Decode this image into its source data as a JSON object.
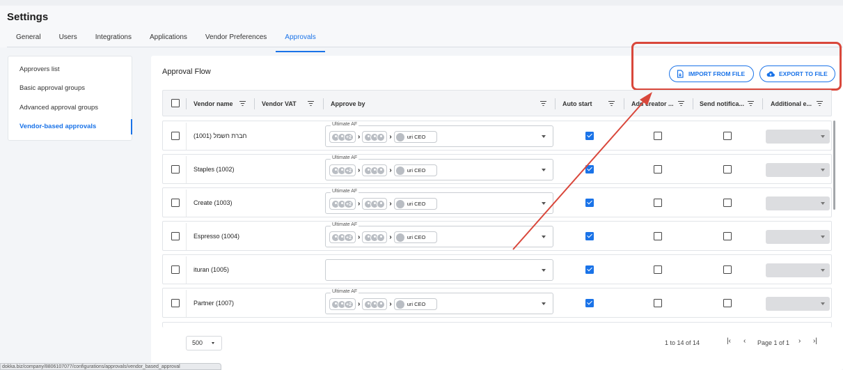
{
  "page": {
    "title": "Settings"
  },
  "tabs": [
    "General",
    "Users",
    "Integrations",
    "Applications",
    "Vendor Preferences",
    "Approvals"
  ],
  "active_tab": "Approvals",
  "sidebar": {
    "items": [
      {
        "label": "Approvers list"
      },
      {
        "label": "Basic approval groups"
      },
      {
        "label": "Advanced approval groups"
      },
      {
        "label": "Vendor-based approvals"
      }
    ],
    "active": "Vendor-based approvals"
  },
  "panel": {
    "title": "Approval Flow",
    "import_label": "IMPORT FROM FILE",
    "export_label": "EXPORT TO FILE"
  },
  "table": {
    "columns": [
      "Vendor name",
      "Vendor VAT",
      "Approve by",
      "Auto start",
      "Add creator ...",
      "Send notifica...",
      "Additional e..."
    ],
    "rows": [
      {
        "vendor": "חברת חשמל (1001)",
        "legend": "Ultimate AF",
        "approver": "uri CEO",
        "auto_start": true
      },
      {
        "vendor": "Staples (1002)",
        "legend": "Ultimate AF",
        "approver": "uri CEO",
        "auto_start": true
      },
      {
        "vendor": "Create (1003)",
        "legend": "Ultimate AF",
        "approver": "uri CEO",
        "auto_start": true
      },
      {
        "vendor": "Espresso (1004)",
        "legend": "Ultimate AF",
        "approver": "uri CEO",
        "auto_start": true
      },
      {
        "vendor": "ituran (1005)",
        "legend": "",
        "approver": "",
        "auto_start": true
      },
      {
        "vendor": "Partner (1007)",
        "legend": "Ultimate AF",
        "approver": "uri CEO",
        "auto_start": true
      }
    ],
    "plus_count": "+2"
  },
  "footer": {
    "page_size": "500",
    "count": "1 to 14 of 14",
    "page_info": "Page 1 of 1"
  },
  "status_url": "dokka.biz/company/8806107077/configurations/approvals/vendor_based_approval",
  "colors": {
    "accent": "#1a73e8",
    "highlight": "#d9473b"
  }
}
